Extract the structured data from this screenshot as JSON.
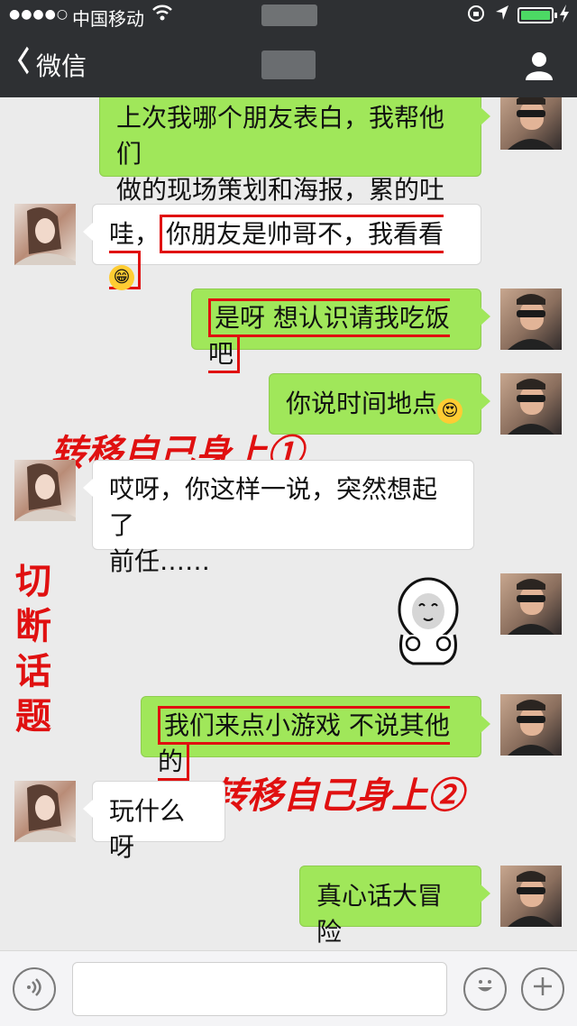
{
  "status_bar": {
    "signal": "●●●●○",
    "carrier": "中国移动",
    "colors": {
      "battery": "#4cd964"
    }
  },
  "nav": {
    "back_label": "微信",
    "colors": {
      "bar": "#2e3033"
    }
  },
  "messages": [
    {
      "from": "me",
      "lines": [
        "上次我哪个朋友表白，我帮他们",
        "做的现场策划和海报，累的吐血"
      ]
    },
    {
      "from": "her",
      "prefix": "哇，",
      "boxed": "你朋友是帅哥不，我看看",
      "emoji": "grinning-emoji"
    },
    {
      "from": "me",
      "boxed": "是呀 想认识请我吃饭吧"
    },
    {
      "from": "me",
      "text": "你说时间地点",
      "emoji": "heart-eyes-emoji"
    },
    {
      "from": "her",
      "lines": [
        "哎呀，你这样一说，突然想起了",
        "前任……"
      ]
    },
    {
      "from": "me",
      "sticker": "cartoon-face-sticker"
    },
    {
      "from": "me",
      "boxed": "我们来点小游戏 不说其他的"
    },
    {
      "from": "her",
      "text": "玩什么呀"
    },
    {
      "from": "me",
      "text": "真心话大冒险"
    }
  ],
  "annotations": {
    "first": "转移自己身上①",
    "second": "转移自己身上②",
    "vertical": [
      "切",
      "断",
      "话",
      "题"
    ]
  },
  "colors": {
    "outgoing_bubble": "#a0e75a",
    "incoming_bubble": "#ffffff",
    "annotation_red": "#e01010",
    "chat_background": "#ebebeb"
  },
  "input_bar": {
    "voice_icon": "voice-icon",
    "emoji_icon": "emoji-icon",
    "plus_icon": "plus-icon",
    "text_value": ""
  }
}
